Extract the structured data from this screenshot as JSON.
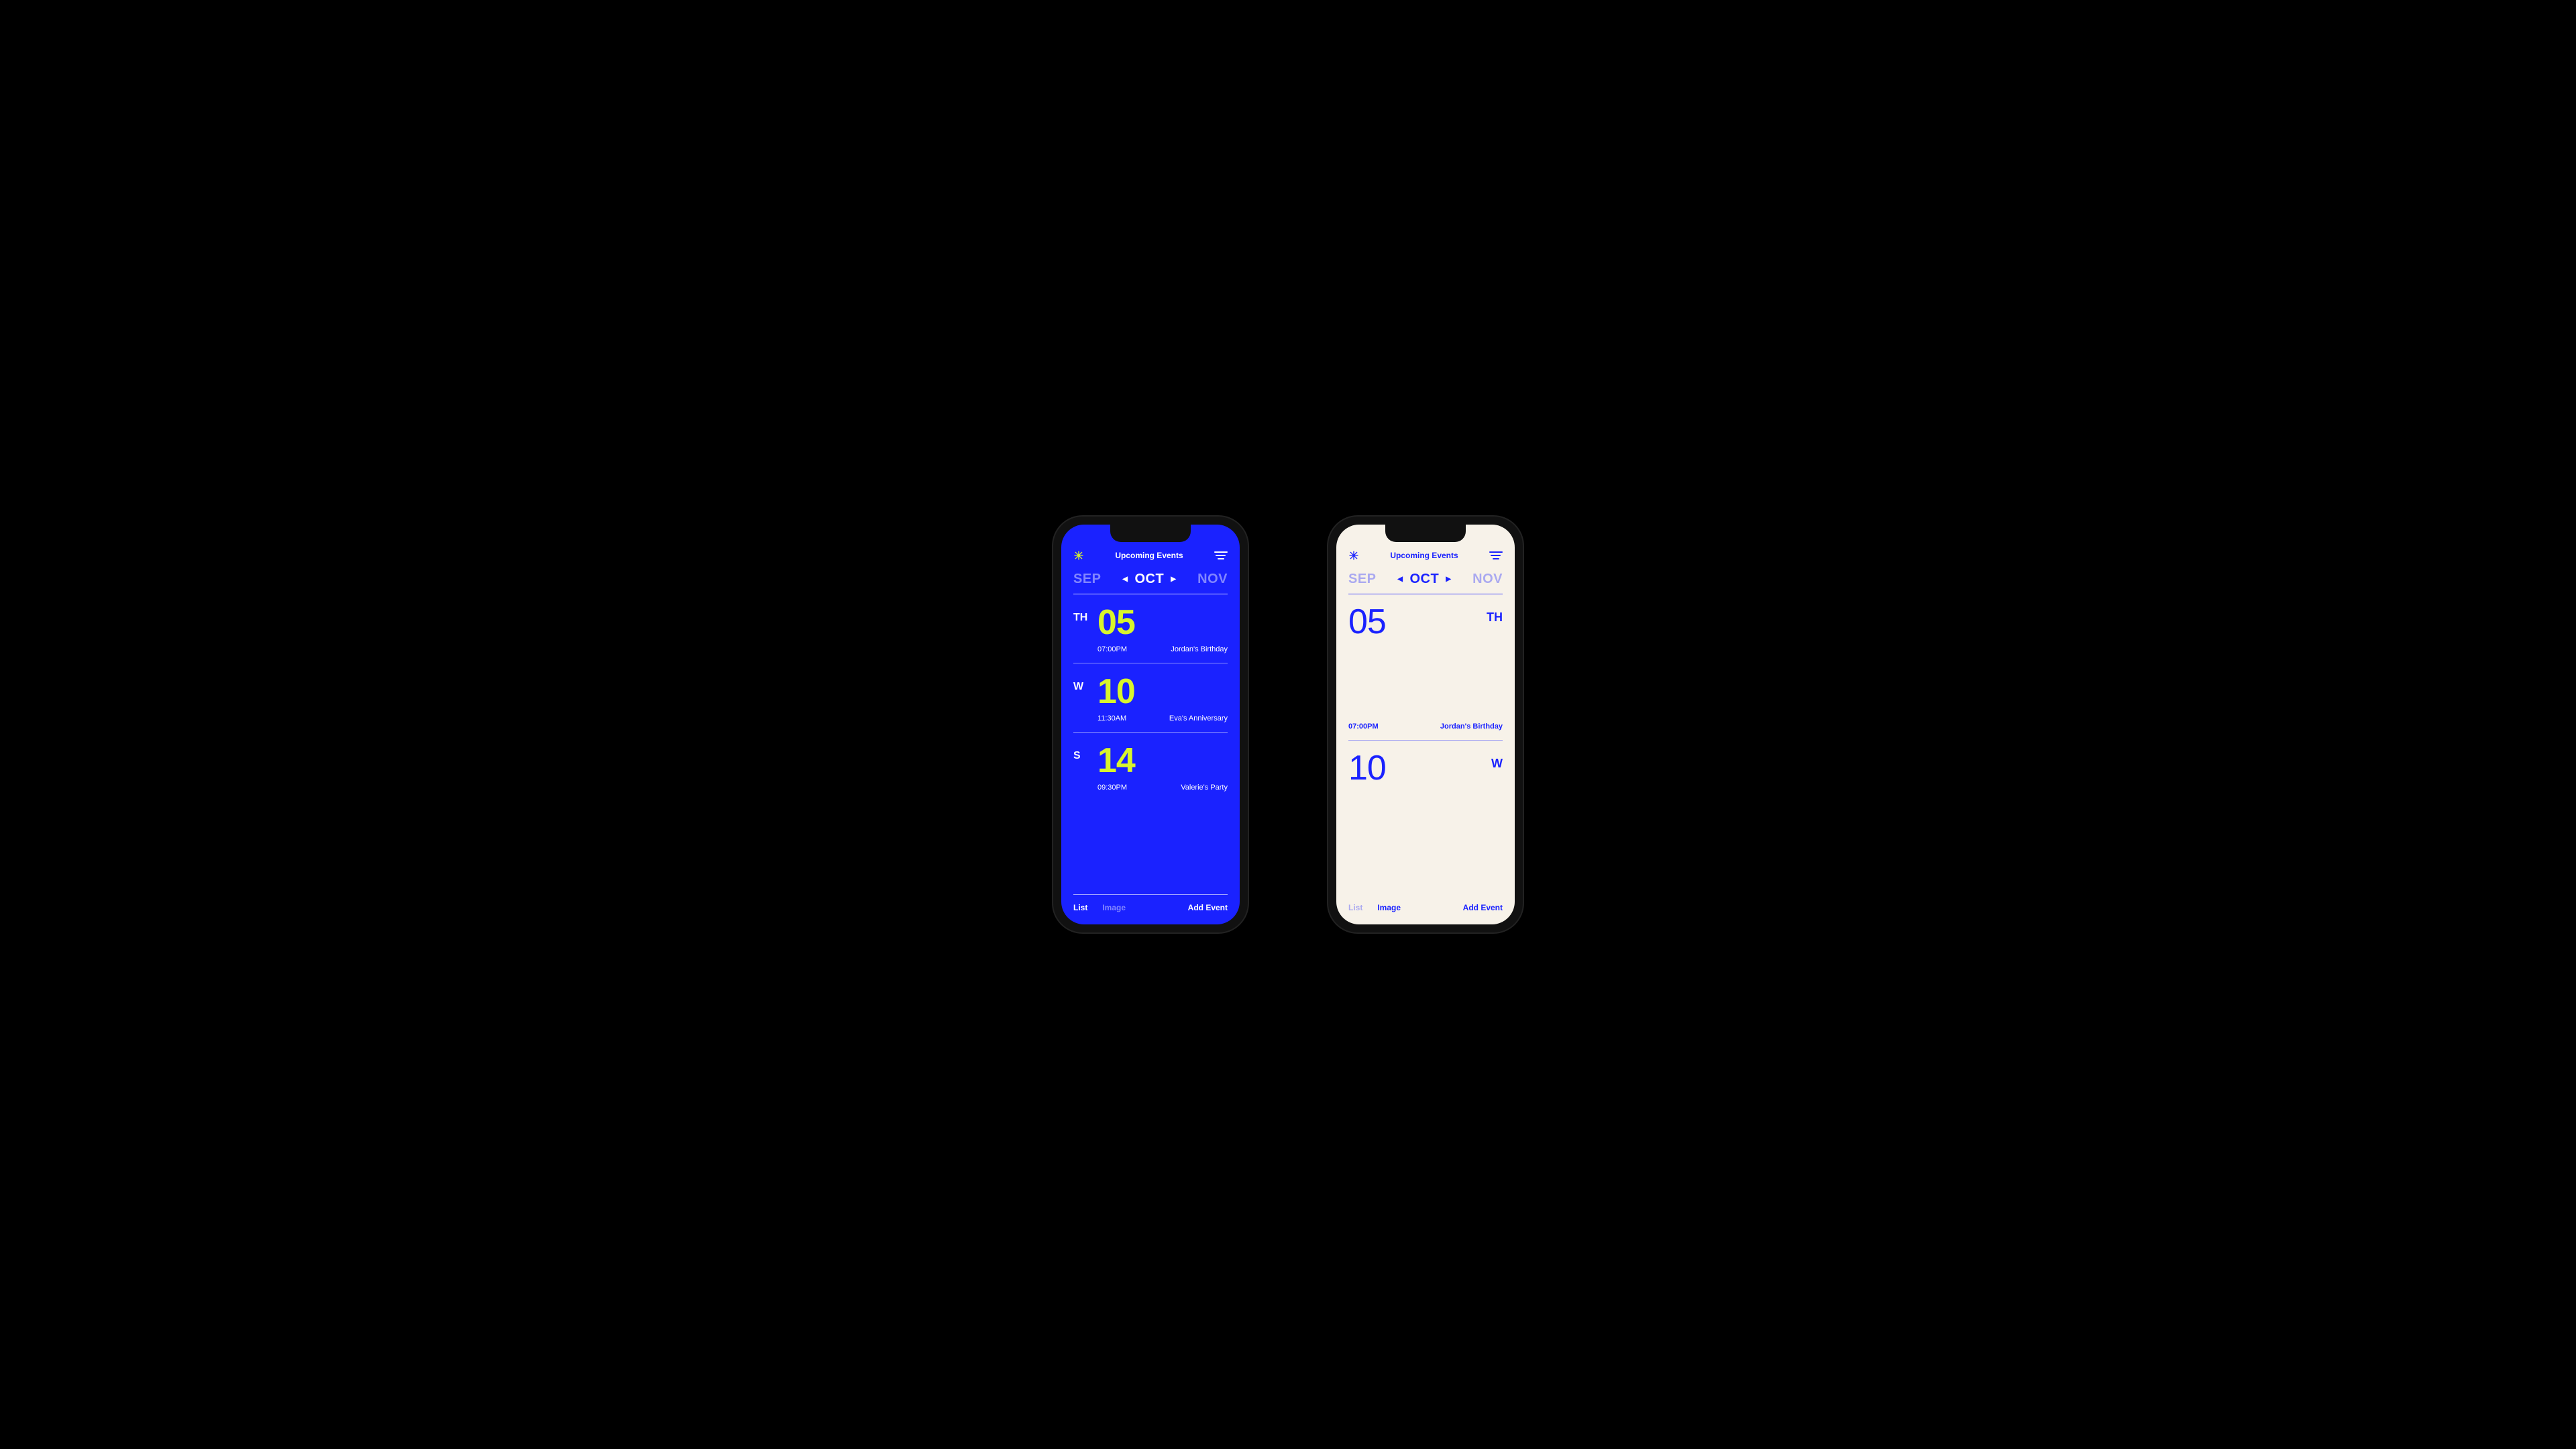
{
  "header": {
    "title": "Upcoming Events"
  },
  "months": {
    "prev": "SEP",
    "current": "OCT",
    "next": "NOV"
  },
  "events": [
    {
      "weekday": "TH",
      "day": "05",
      "time": "07:00PM",
      "title": "Jordan's Birthday"
    },
    {
      "weekday": "W",
      "day": "10",
      "time": "11:30AM",
      "title": "Eva's Anniversary"
    },
    {
      "weekday": "S",
      "day": "14",
      "time": "09:30PM",
      "title": "Valerie's Party"
    }
  ],
  "footer": {
    "list": "List",
    "image": "Image",
    "add": "Add Event"
  }
}
